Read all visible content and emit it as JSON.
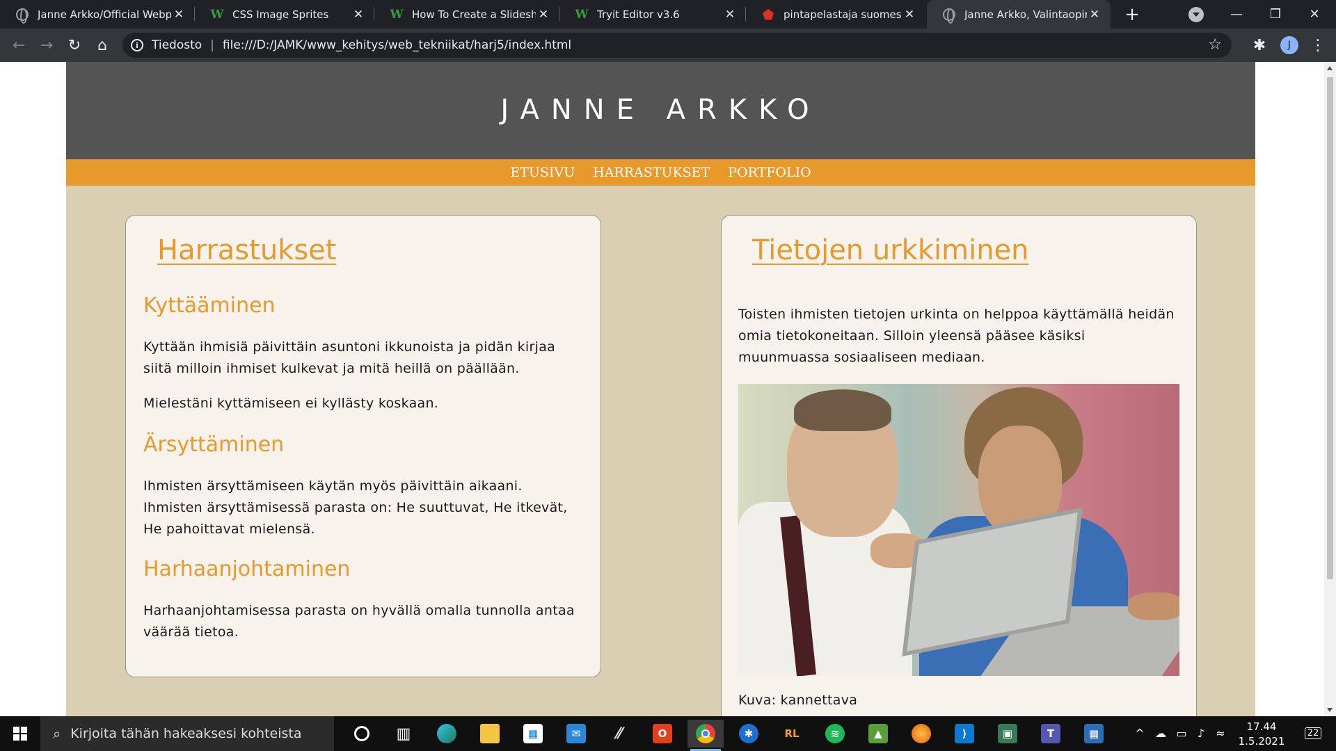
{
  "browser": {
    "tabs": [
      {
        "title": "Janne Arkko/Official Webpage",
        "icon": "globe-icon"
      },
      {
        "title": "CSS Image Sprites",
        "icon": "w3schools-icon"
      },
      {
        "title": "How To Create a Slideshow",
        "icon": "w3schools-icon"
      },
      {
        "title": "Tryit Editor v3.6",
        "icon": "w3schools-icon"
      },
      {
        "title": "pintapelastaja suomesta englanniksi",
        "icon": "dictionary-icon"
      },
      {
        "title": "Janne Arkko, Valintaopintojakso",
        "icon": "globe-icon"
      }
    ],
    "active_tab_index": 5,
    "new_tab_label": "+",
    "address": {
      "security_label": "Tiedosto",
      "url": "file:///D:/JAMK/www_kehitys/web_tekniikat/harj5/index.html"
    },
    "profile_initial": "J"
  },
  "site": {
    "title": "JANNE ARKKO",
    "nav": [
      "ETUSIVU",
      "HARRASTUKSET",
      "PORTFOLIO"
    ],
    "left": {
      "heading": "Harrastukset",
      "sections": [
        {
          "title": "Kyttääminen",
          "paragraphs": [
            "Kyttään ihmisiä päivittäin asuntoni ikkunoista ja pidän kirjaa siitä milloin ihmiset kulkevat ja mitä heillä on päällään.",
            "Mielestäni kyttämiseen ei kyllästy koskaan."
          ]
        },
        {
          "title": "Ärsyttäminen",
          "paragraphs": [
            "Ihmisten ärsyttämiseen käytän myös päivittäin aikaani. Ihmisten ärsyttämisessä parasta on: He suuttuvat, He itkevät, He pahoittavat mielensä."
          ]
        },
        {
          "title": "Harhaanjohtaminen",
          "paragraphs": [
            "Harhaanjohtamisessa parasta on hyvällä omalla tunnolla antaa väärää tietoa."
          ]
        }
      ]
    },
    "right": {
      "heading": "Tietojen urkkiminen",
      "paragraph": "Toisten ihmisten tietojen urkinta on helppoa käyttämällä heidän omia tietokoneitaan. Silloin yleensä pääsee käsiksi muunmuassa sosiaaliseen mediaan.",
      "caption": "Kuva: kannettava"
    },
    "colors": {
      "header_bg": "#555454",
      "nav_bg": "#e8992c",
      "accent": "#e8992c",
      "page_bg": "#d9cfb2",
      "card_bg": "#f7f3ec"
    }
  },
  "taskbar": {
    "search_placeholder": "Kirjoita tähän hakeaksesi kohteista",
    "apps": [
      "task-view-icon",
      "edge-icon",
      "file-explorer-icon",
      "store-icon",
      "mail-icon",
      "app-icon",
      "office-icon",
      "chrome-icon",
      "app-icon",
      "app-icon",
      "spotify-icon",
      "app-icon",
      "firefox-icon",
      "vscode-icon",
      "app-icon",
      "teams-icon",
      "calculator-icon"
    ],
    "time": "17.44",
    "date": "1.5.2021",
    "notification_count": "22"
  }
}
